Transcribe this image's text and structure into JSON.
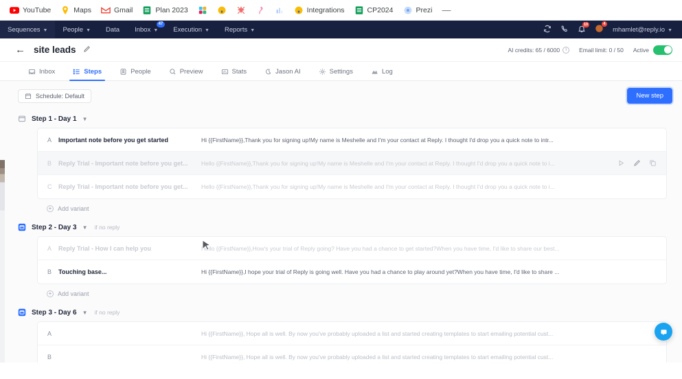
{
  "bookmarks": [
    {
      "label": "YouTube",
      "icon": "youtube-icon"
    },
    {
      "label": "Maps",
      "icon": "maps-pin-icon"
    },
    {
      "label": "Gmail",
      "icon": "gmail-icon"
    },
    {
      "label": "Plan 2023",
      "icon": "sheets-icon"
    },
    {
      "label": "",
      "icon": "slack-icon"
    },
    {
      "label": "",
      "icon": "keep-icon"
    },
    {
      "label": "",
      "icon": "asana-icon"
    },
    {
      "label": "",
      "icon": "flamingo-icon"
    },
    {
      "label": "",
      "icon": "analytics-icon"
    },
    {
      "label": "Integrations",
      "icon": "keep-icon"
    },
    {
      "label": "CP2024",
      "icon": "sheets-icon"
    },
    {
      "label": "Prezi",
      "icon": "prezi-icon"
    }
  ],
  "bookmarks_overflow": "—",
  "nav": {
    "items": [
      {
        "label": "Sequences",
        "caret": true,
        "badge": ""
      },
      {
        "label": "People",
        "caret": true,
        "badge": ""
      },
      {
        "label": "Data",
        "caret": false,
        "badge": ""
      },
      {
        "label": "Inbox",
        "caret": true,
        "badge": "47"
      },
      {
        "label": "Execution",
        "caret": true,
        "badge": ""
      },
      {
        "label": "Reports",
        "caret": true,
        "badge": ""
      }
    ],
    "sync_icon": "sync-icon",
    "call_icon": "phone-icon",
    "notifications_icon": "bell-icon",
    "notifications_badge": "10",
    "alerts_icon": "alert-icon",
    "alerts_badge": "4",
    "user_email": "mhamlet@reply.io"
  },
  "header": {
    "back_icon": "back-arrow-icon",
    "title": "site leads",
    "edit_icon": "pencil-icon",
    "ai_credits": "AI credits: 65 / 6000",
    "email_limit": "Email limit: 0 / 50",
    "active_label": "Active",
    "info_char": "i"
  },
  "tabs": [
    {
      "label": "Inbox",
      "icon": "inbox-icon",
      "active": false
    },
    {
      "label": "Steps",
      "icon": "steps-list-icon",
      "active": true
    },
    {
      "label": "People",
      "icon": "people-icon",
      "active": false
    },
    {
      "label": "Preview",
      "icon": "search-icon",
      "active": false
    },
    {
      "label": "Stats",
      "icon": "stats-icon",
      "active": false
    },
    {
      "label": "Jason AI",
      "icon": "moon-icon",
      "active": false
    },
    {
      "label": "Settings",
      "icon": "gear-icon",
      "active": false
    },
    {
      "label": "Log",
      "icon": "log-icon",
      "active": false
    }
  ],
  "toolbar": {
    "schedule_label": "Schedule: Default",
    "schedule_icon": "calendar-icon",
    "new_step_label": "New step"
  },
  "add_variant_label": "Add variant",
  "steps": [
    {
      "label": "Step 1 - Day 1",
      "icon_style": "outline",
      "if_no_reply": "",
      "variants": [
        {
          "letter": "A",
          "subject": "Important note before you get started",
          "preview": "Hi {{FirstName}},Thank you for signing up!My name is Meshelle and I'm your contact at Reply. I thought I'd drop you a quick note to intr...",
          "state": "normal",
          "actions": false
        },
        {
          "letter": "B",
          "subject": "Reply Trial - Important note before you get...",
          "preview": "Hello {{FirstName}},Thank you for signing up!My name is Meshelle and I'm your contact at Reply. I thought I'd drop you a quick note to i...",
          "state": "dim",
          "actions": true
        },
        {
          "letter": "C",
          "subject": "Reply Trial - Important note before you get...",
          "preview": "Hello {{FirstName}},Thank you for signing up!My name is Meshelle and I'm your contact at Reply. I thought I'd drop you a quick note to i...",
          "state": "dim",
          "actions": false
        }
      ]
    },
    {
      "label": "Step 2 - Day 3",
      "icon_style": "filled",
      "if_no_reply": "if no reply",
      "variants": [
        {
          "letter": "A",
          "subject": "Reply Trial - How I can help you",
          "preview": "Hello {{FirstName}},How's your trial of Reply going? Have you had a chance to get started?When you have time, I'd like to share our best...",
          "state": "dim",
          "actions": false
        },
        {
          "letter": "B",
          "subject": "Touching base...",
          "preview": "Hi {{FirstName}},I hope your trial of Reply is going well. Have you had a chance to play around yet?When you have time, I'd like to share ...",
          "state": "normal",
          "actions": false
        }
      ]
    },
    {
      "label": "Step 3 - Day 6",
      "icon_style": "filled",
      "if_no_reply": "if no reply",
      "variants": [
        {
          "letter": "A",
          "subject": "",
          "preview": "Hi {{FirstName}}, Hope all is well. By now you've probably uploaded a list and started creating templates to start emailing potential cust...",
          "state": "faint",
          "actions": false
        },
        {
          "letter": "B",
          "subject": "",
          "preview": "Hi {{FirstName}}, Hope all is well. By now you've probably uploaded a list and started creating templates to start emailing potential cust...",
          "state": "faint",
          "actions": false
        }
      ]
    }
  ],
  "row_actions": [
    {
      "name": "preview-icon"
    },
    {
      "name": "edit-icon"
    },
    {
      "name": "duplicate-icon"
    }
  ],
  "chat_widget": {
    "icon": "chat-icon"
  },
  "colors": {
    "accent": "#2e6fff",
    "nav_bg": "#17203f",
    "active_green": "#25c16f",
    "badge_red": "#f0483e",
    "chat_blue": "#1aa3f0"
  }
}
